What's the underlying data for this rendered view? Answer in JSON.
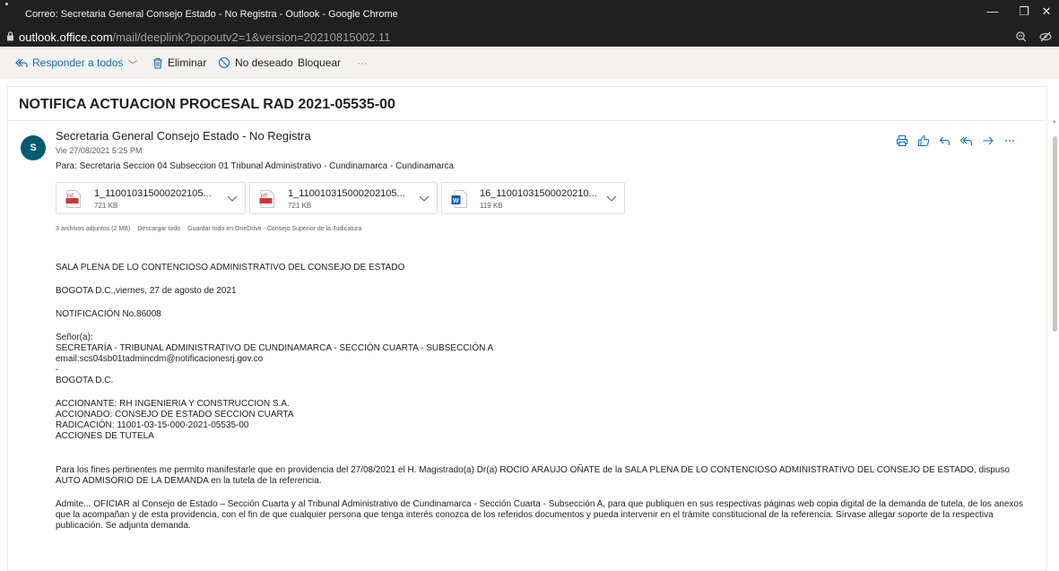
{
  "window": {
    "title": "Correo: Secretaria General Consejo Estado - No Registra - Outlook - Google Chrome",
    "minimize": "—",
    "maximize": "❐",
    "close": "✕"
  },
  "address": {
    "host": "outlook.office.com",
    "path": "/mail/deeplink?popoutv2=1&version=20210815002.11"
  },
  "toolbar": {
    "reply_all": "Responder a todos",
    "delete": "Eliminar",
    "junk": "No deseado",
    "block": "Bloquear",
    "more": "···"
  },
  "message": {
    "subject": "NOTIFICA ACTUACION PROCESAL RAD 2021-05535-00",
    "avatar_initial": "S",
    "avatar_color": "#005a71",
    "sender": "Secretaria General Consejo Estado - No Registra",
    "date": "Vie 27/08/2021 5:25 PM",
    "to": "Para:  Secretaria Seccion 04 Subseccion 01 Tribunal Administrativo - Cundinamarca - Cundinamarca"
  },
  "attachments": [
    {
      "name": "1_110010315000202105...",
      "size": "721 KB",
      "type": "pdf"
    },
    {
      "name": "1_110010315000202105...",
      "size": "721 KB",
      "type": "pdf"
    },
    {
      "name": "16_11001031500020210...",
      "size": "119 KB",
      "type": "word"
    }
  ],
  "attachment_info": {
    "count": "3 archivos adjuntos (2 MB)",
    "download_all": "Descargar todo",
    "save_onedrive": "Guardar todo en OneDrive - Consejo Superior de la Judicatura"
  },
  "body": {
    "l1": "SALA PLENA DE LO CONTENCIOSO ADMINISTRATIVO DEL CONSEJO DE ESTADO",
    "l2": "BOGOTA D.C.,viernes, 27 de agosto de 2021",
    "l3": "NOTIFICACIÓN No.86008",
    "l4a": "Señor(a):",
    "l4b": "SECRETARÍA - TRIBUNAL ADMINISTRATIVO DE CUNDINAMARCA - SECCIÓN CUARTA - SUBSECCIÓN A",
    "l4c": "email:scs04sb01tadmincdm@notificacionesrj.gov.co",
    "l4d": "-",
    "l4e": "BOGOTA D.C.",
    "l5a": "ACCIONANTE: RH INGENIERIA Y CONSTRUCCION S.A.",
    "l5b": "ACCIONADO: CONSEJO DE ESTADO SECCION CUARTA",
    "l5c": "RADICACIÓN: 11001-03-15-000-2021-05535-00",
    "l5d": "ACCIONES DE TUTELA",
    "p1": "Para los fines pertinentes me permito manifestarle que en providencia del 27/08/2021  el H. Magistrado(a) Dr(a) ROCIO ARAUJO OÑATE de la SALA PLENA DE LO CONTENCIOSO ADMINISTRATIVO DEL CONSEJO DE ESTADO, dispuso AUTO ADMISORIO DE LA DEMANDA en la tutela de la referencia.",
    "p2": "Admite...    OFICIAR al Consejo de Estado – Sección Cuarta y al Tribunal Administrativo de Cundinamarca - Sección Cuarta - Subsección A, para que publiquen en sus respectivas páginas web copia digital de la demanda de tutela, de los anexos que la acompañan y de esta providencia, con el fin de que cualquier persona que tenga interés conozca de los referidos documentos y pueda intervenir en el trámite constitucional de la referencia.  Sírvase allegar soporte de la respectiva publicación.   Se adjunta demanda."
  },
  "colors": {
    "accent": "#0f6cbd",
    "chrome_bg": "#202020",
    "toolbar_bg": "#f3f2f1",
    "pdf": "#d13438",
    "word": "#185abd"
  }
}
